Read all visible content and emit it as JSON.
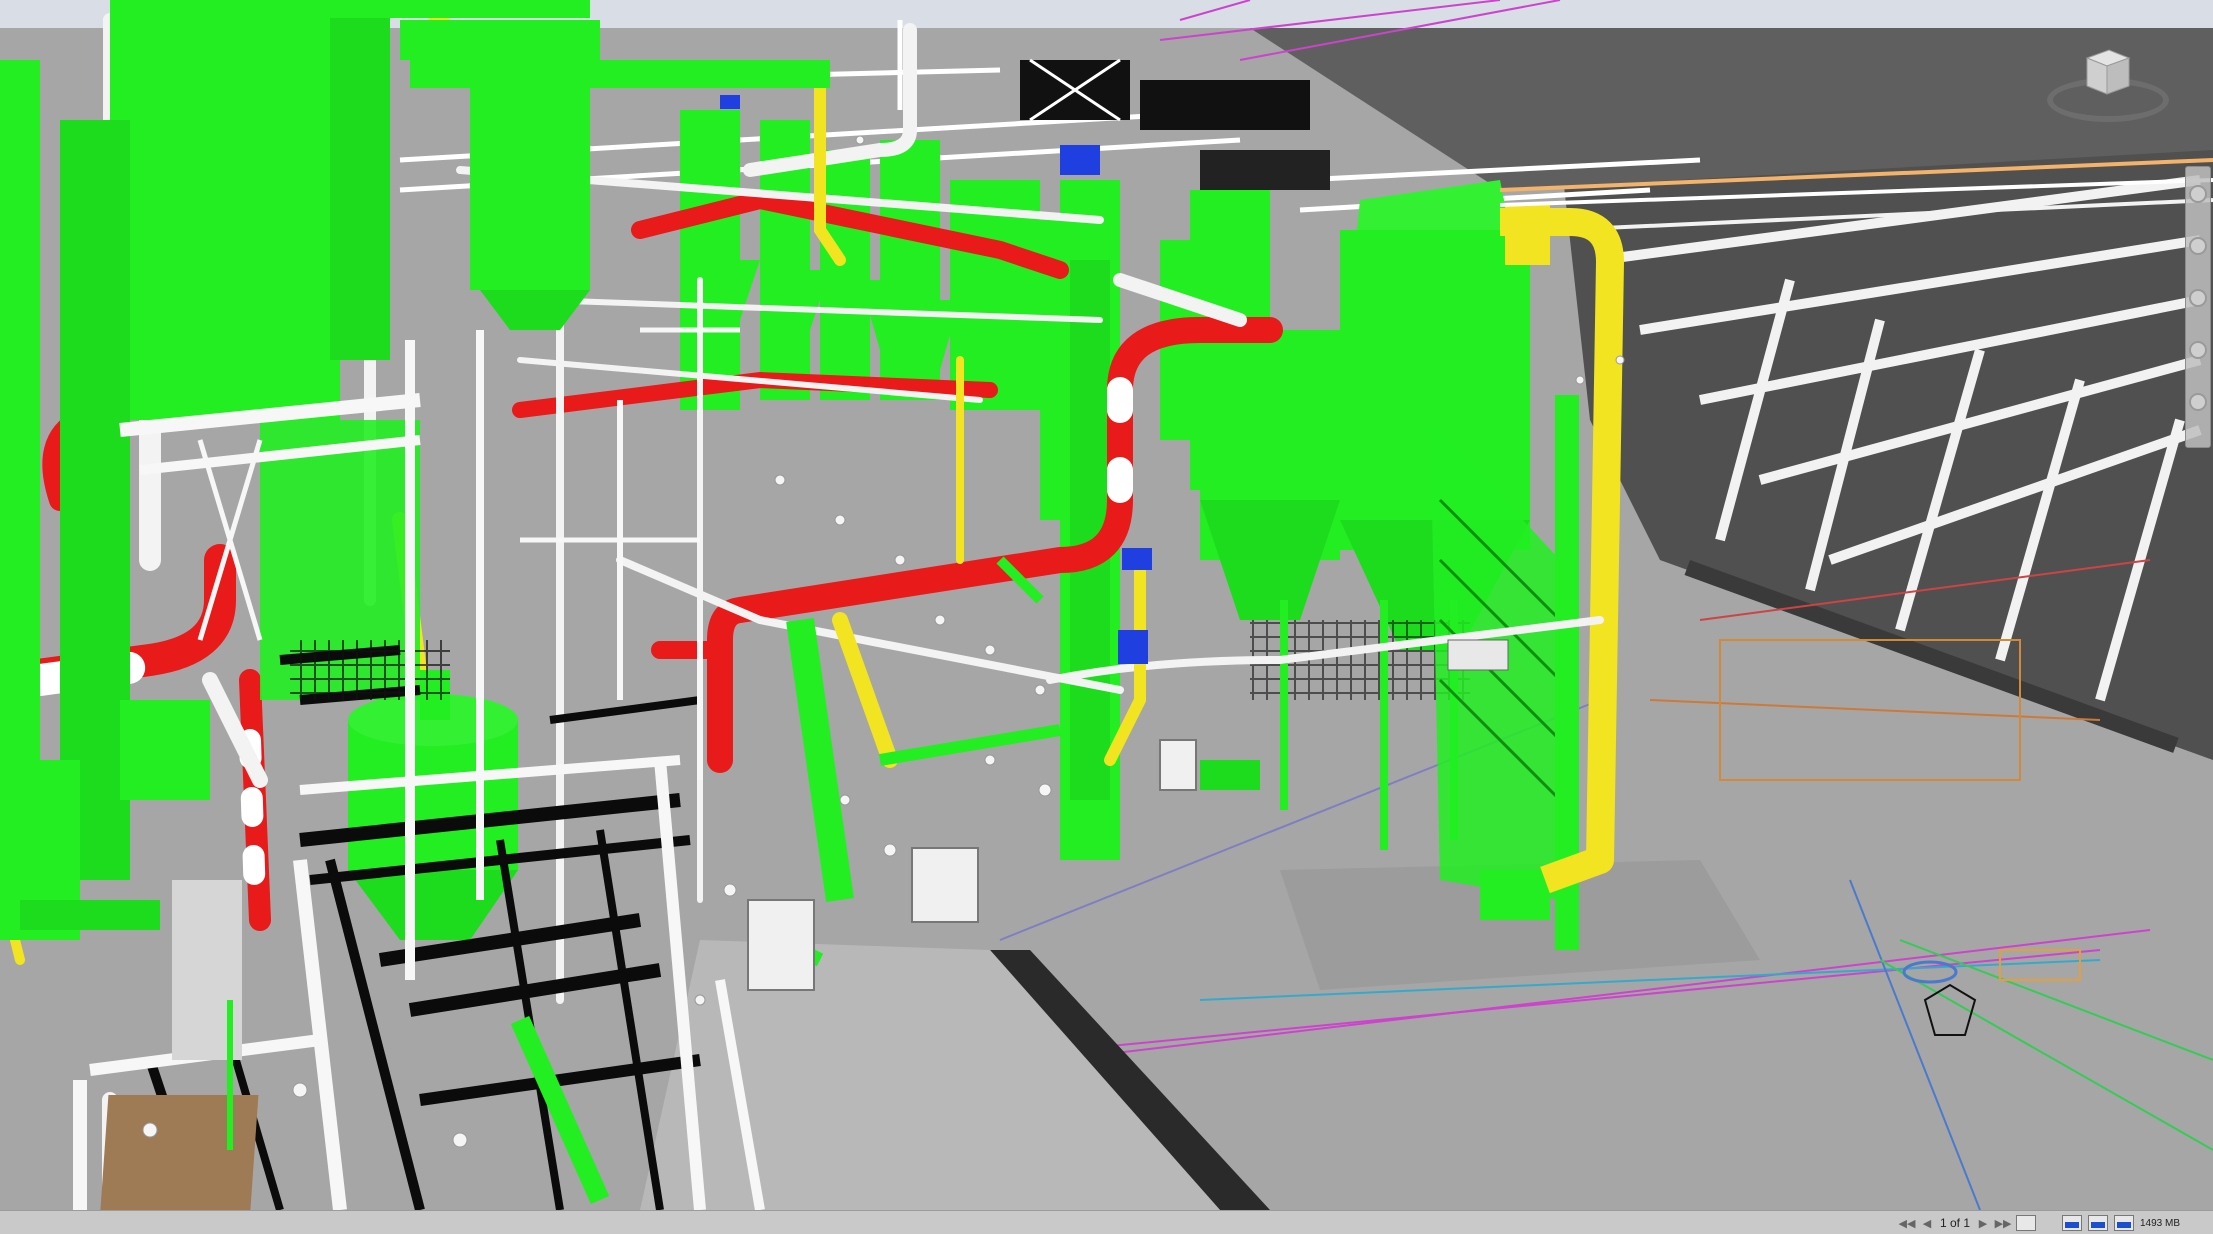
{
  "statusbar": {
    "page_label": "1 of 1",
    "memory_label": "1493 MB",
    "first_page_icon": "first-page-icon",
    "prev_page_icon": "prev-page-icon",
    "next_page_icon": "next-page-icon",
    "last_page_icon": "last-page-icon",
    "sheets_icon": "sheets-icon"
  },
  "viewcube": {
    "icon": "viewcube-icon"
  },
  "navbar": {
    "icons": [
      "steering-wheel-icon",
      "pan-icon",
      "zoom-icon",
      "orbit-icon",
      "look-icon"
    ]
  },
  "colors": {
    "equipment": "#22ee22",
    "pipe_hot": "#e81a1a",
    "pipe_yellow": "#f2e420",
    "steel": "#ffffff",
    "ground": "#a6a6a6",
    "roof": "#555555"
  }
}
